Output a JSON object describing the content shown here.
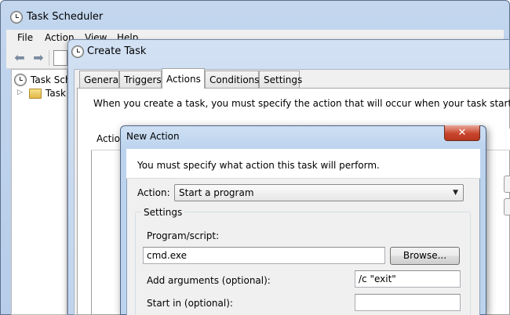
{
  "task_scheduler": {
    "title": "Task Scheduler",
    "menu": [
      "File",
      "Action",
      "View",
      "Help"
    ],
    "tree": {
      "root_label": "Task Scheduler",
      "child_label": "Task Scheduler Library",
      "expander": "▷"
    },
    "icons": {
      "back": "back-arrow-icon",
      "forward": "forward-arrow-icon"
    }
  },
  "create_task": {
    "title": "Create Task",
    "tabs": [
      "General",
      "Triggers",
      "Actions",
      "Conditions",
      "Settings"
    ],
    "active_tab": "Actions",
    "instructions": "When you create a task, you must specify the action that will occur when your task starts.",
    "list_header": "Action"
  },
  "new_action": {
    "title": "New Action",
    "close_glyph": "✕",
    "instructions": "You must specify what action this task will perform.",
    "action_label": "Action:",
    "action_value": "Start a program",
    "settings_legend": "Settings",
    "program_label": "Program/script:",
    "program_value": "cmd.exe",
    "browse_label": "Browse...",
    "arguments_label": "Add arguments (optional):",
    "arguments_value": "/c \"exit\"",
    "start_in_label": "Start in (optional):",
    "start_in_value": ""
  },
  "colors": {
    "title_bar": "#c3d6ee",
    "dialog_face": "#f0f0f0",
    "close_button": "#c8452c"
  }
}
